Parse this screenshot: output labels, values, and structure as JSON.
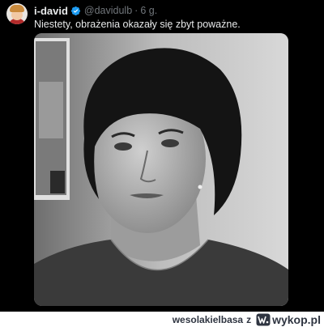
{
  "tweet": {
    "display_name": "i-david",
    "handle": "@davidulb",
    "separator": "·",
    "time": "6 g.",
    "text": "Niestety, obrażenia okazały się zbyt poważne.",
    "icons": {
      "avatar": "profile-avatar",
      "verified": "verified-badge-icon"
    },
    "colors": {
      "background": "#000000",
      "name": "#e7e9ea",
      "muted": "#71767b",
      "verified": "#1d9bf0"
    }
  },
  "watermark": {
    "username": "wesolakielbasa",
    "user_suffix": "z",
    "site": "wykop.pl",
    "icons": {
      "logo": "wykop-logo-icon"
    }
  }
}
